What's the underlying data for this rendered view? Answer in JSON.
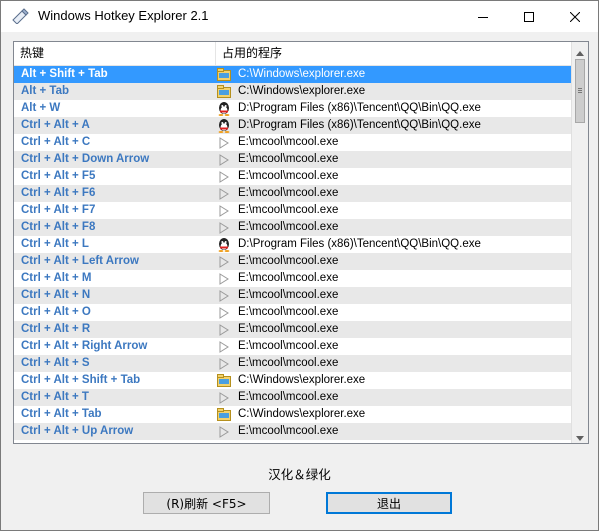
{
  "window": {
    "title": "Windows Hotkey Explorer 2.1",
    "app_icon": "pencil-eraser-icon",
    "controls": [
      "minimize-icon",
      "maximize-icon",
      "close-icon"
    ]
  },
  "table": {
    "headers": [
      "热键",
      "占用的程序"
    ],
    "rows": [
      {
        "key": "Alt + Shift + Tab",
        "icon": "explorer-icon",
        "path": "C:\\Windows\\explorer.exe",
        "selected": true
      },
      {
        "key": "Alt + Tab",
        "icon": "explorer-icon",
        "path": "C:\\Windows\\explorer.exe"
      },
      {
        "key": "Alt + W",
        "icon": "qq-penguin-icon",
        "path": "D:\\Program Files (x86)\\Tencent\\QQ\\Bin\\QQ.exe"
      },
      {
        "key": "Ctrl + Alt + A",
        "icon": "qq-penguin-icon",
        "path": "D:\\Program Files (x86)\\Tencent\\QQ\\Bin\\QQ.exe"
      },
      {
        "key": "Ctrl + Alt + C",
        "icon": "play-icon",
        "path": "E:\\mcool\\mcool.exe"
      },
      {
        "key": "Ctrl + Alt + Down Arrow",
        "icon": "play-icon",
        "path": "E:\\mcool\\mcool.exe"
      },
      {
        "key": "Ctrl + Alt + F5",
        "icon": "play-icon",
        "path": "E:\\mcool\\mcool.exe"
      },
      {
        "key": "Ctrl + Alt + F6",
        "icon": "play-icon",
        "path": "E:\\mcool\\mcool.exe"
      },
      {
        "key": "Ctrl + Alt + F7",
        "icon": "play-icon",
        "path": "E:\\mcool\\mcool.exe"
      },
      {
        "key": "Ctrl + Alt + F8",
        "icon": "play-icon",
        "path": "E:\\mcool\\mcool.exe"
      },
      {
        "key": "Ctrl + Alt + L",
        "icon": "qq-penguin-icon",
        "path": "D:\\Program Files (x86)\\Tencent\\QQ\\Bin\\QQ.exe"
      },
      {
        "key": "Ctrl + Alt + Left Arrow",
        "icon": "play-icon",
        "path": "E:\\mcool\\mcool.exe"
      },
      {
        "key": "Ctrl + Alt + M",
        "icon": "play-icon",
        "path": "E:\\mcool\\mcool.exe"
      },
      {
        "key": "Ctrl + Alt + N",
        "icon": "play-icon",
        "path": "E:\\mcool\\mcool.exe"
      },
      {
        "key": "Ctrl + Alt + O",
        "icon": "play-icon",
        "path": "E:\\mcool\\mcool.exe"
      },
      {
        "key": "Ctrl + Alt + R",
        "icon": "play-icon",
        "path": "E:\\mcool\\mcool.exe"
      },
      {
        "key": "Ctrl + Alt + Right Arrow",
        "icon": "play-icon",
        "path": "E:\\mcool\\mcool.exe"
      },
      {
        "key": "Ctrl + Alt + S",
        "icon": "play-icon",
        "path": "E:\\mcool\\mcool.exe"
      },
      {
        "key": "Ctrl + Alt + Shift + Tab",
        "icon": "explorer-icon",
        "path": "C:\\Windows\\explorer.exe"
      },
      {
        "key": "Ctrl + Alt + T",
        "icon": "play-icon",
        "path": "E:\\mcool\\mcool.exe"
      },
      {
        "key": "Ctrl + Alt + Tab",
        "icon": "explorer-icon",
        "path": "C:\\Windows\\explorer.exe"
      },
      {
        "key": "Ctrl + Alt + Up Arrow",
        "icon": "play-icon",
        "path": "E:\\mcool\\mcool.exe"
      }
    ]
  },
  "footer": {
    "credit": "汉化＆绿化",
    "refresh_label": "(R)刷新 <F5>",
    "exit_label": "退出"
  },
  "colors": {
    "selection": "#3399ff",
    "hotkey_text": "#3c78c0",
    "alt_row": "#e8e8e8"
  }
}
